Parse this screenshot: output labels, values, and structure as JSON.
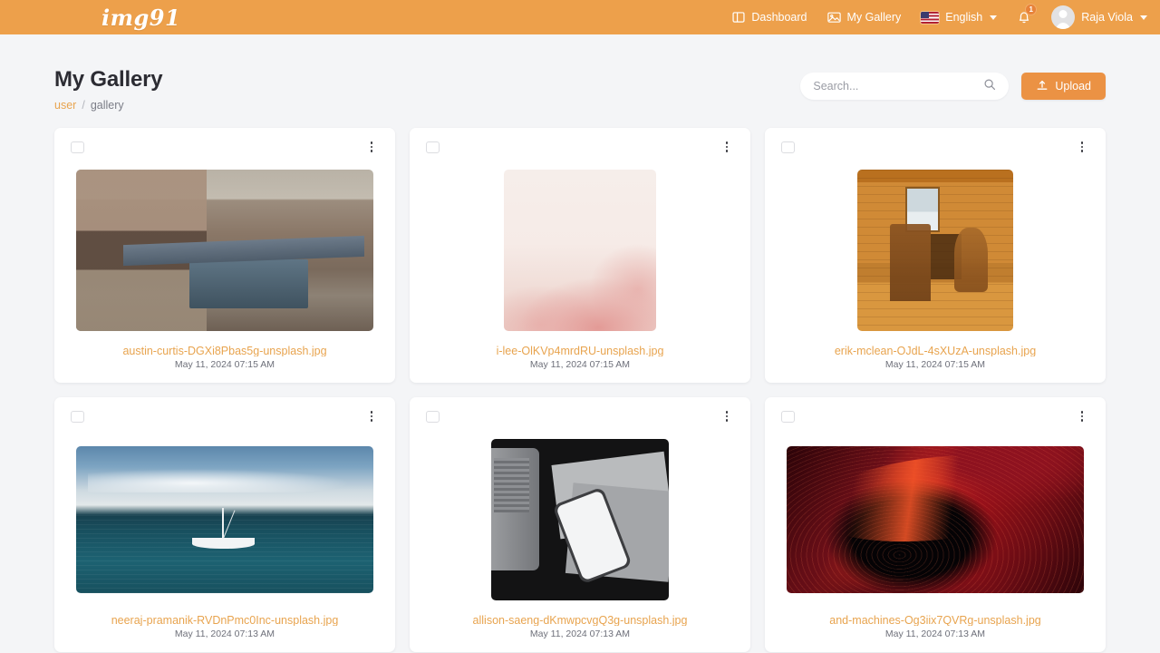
{
  "brand": {
    "name": "img91"
  },
  "nav": {
    "dashboard": {
      "label": "Dashboard",
      "icon": "dashboard-icon"
    },
    "gallery": {
      "label": "My Gallery",
      "icon": "image-icon"
    },
    "language": {
      "label": "English",
      "icon": "us-flag-icon"
    },
    "notifications": {
      "count": "1",
      "icon": "bell-icon"
    },
    "user": {
      "name": "Raja Viola",
      "icon": "avatar-icon"
    }
  },
  "header": {
    "title": "My Gallery",
    "breadcrumb": {
      "root": "user",
      "separator": "/",
      "current": "gallery"
    },
    "search_placeholder": "Search...",
    "search_value": "",
    "upload_label": "Upload"
  },
  "colors": {
    "brand_orange": "#eda04b",
    "link_orange": "#e8a44f",
    "button_orange": "#eb9244",
    "page_bg": "#f4f5f7",
    "card_bg": "#ffffff",
    "title": "#2c2c33"
  },
  "gallery": {
    "items": [
      {
        "name": "austin-curtis-DGXi8Pbas5g-unsplash.jpg",
        "date": "May 11, 2024 07:15 AM",
        "checked": false,
        "art": "t-market"
      },
      {
        "name": "i-lee-OlKVp4mrdRU-unsplash.jpg",
        "date": "May 11, 2024 07:15 AM",
        "checked": false,
        "art": "t-floral"
      },
      {
        "name": "erik-mclean-OJdL-4sXUzA-unsplash.jpg",
        "date": "May 11, 2024 07:15 AM",
        "checked": false,
        "art": "t-cabin"
      },
      {
        "name": "neeraj-pramanik-RVDnPmc0Inc-unsplash.jpg",
        "date": "May 11, 2024 07:13 AM",
        "checked": false,
        "art": "t-sea"
      },
      {
        "name": "allison-saeng-dKmwpcvgQ3g-unsplash.jpg",
        "date": "May 11, 2024 07:13 AM",
        "checked": false,
        "art": "t-desk"
      },
      {
        "name": "and-machines-Og3iix7QVRg-unsplash.jpg",
        "date": "May 11, 2024 07:13 AM",
        "checked": false,
        "art": "t-abstract"
      }
    ]
  }
}
